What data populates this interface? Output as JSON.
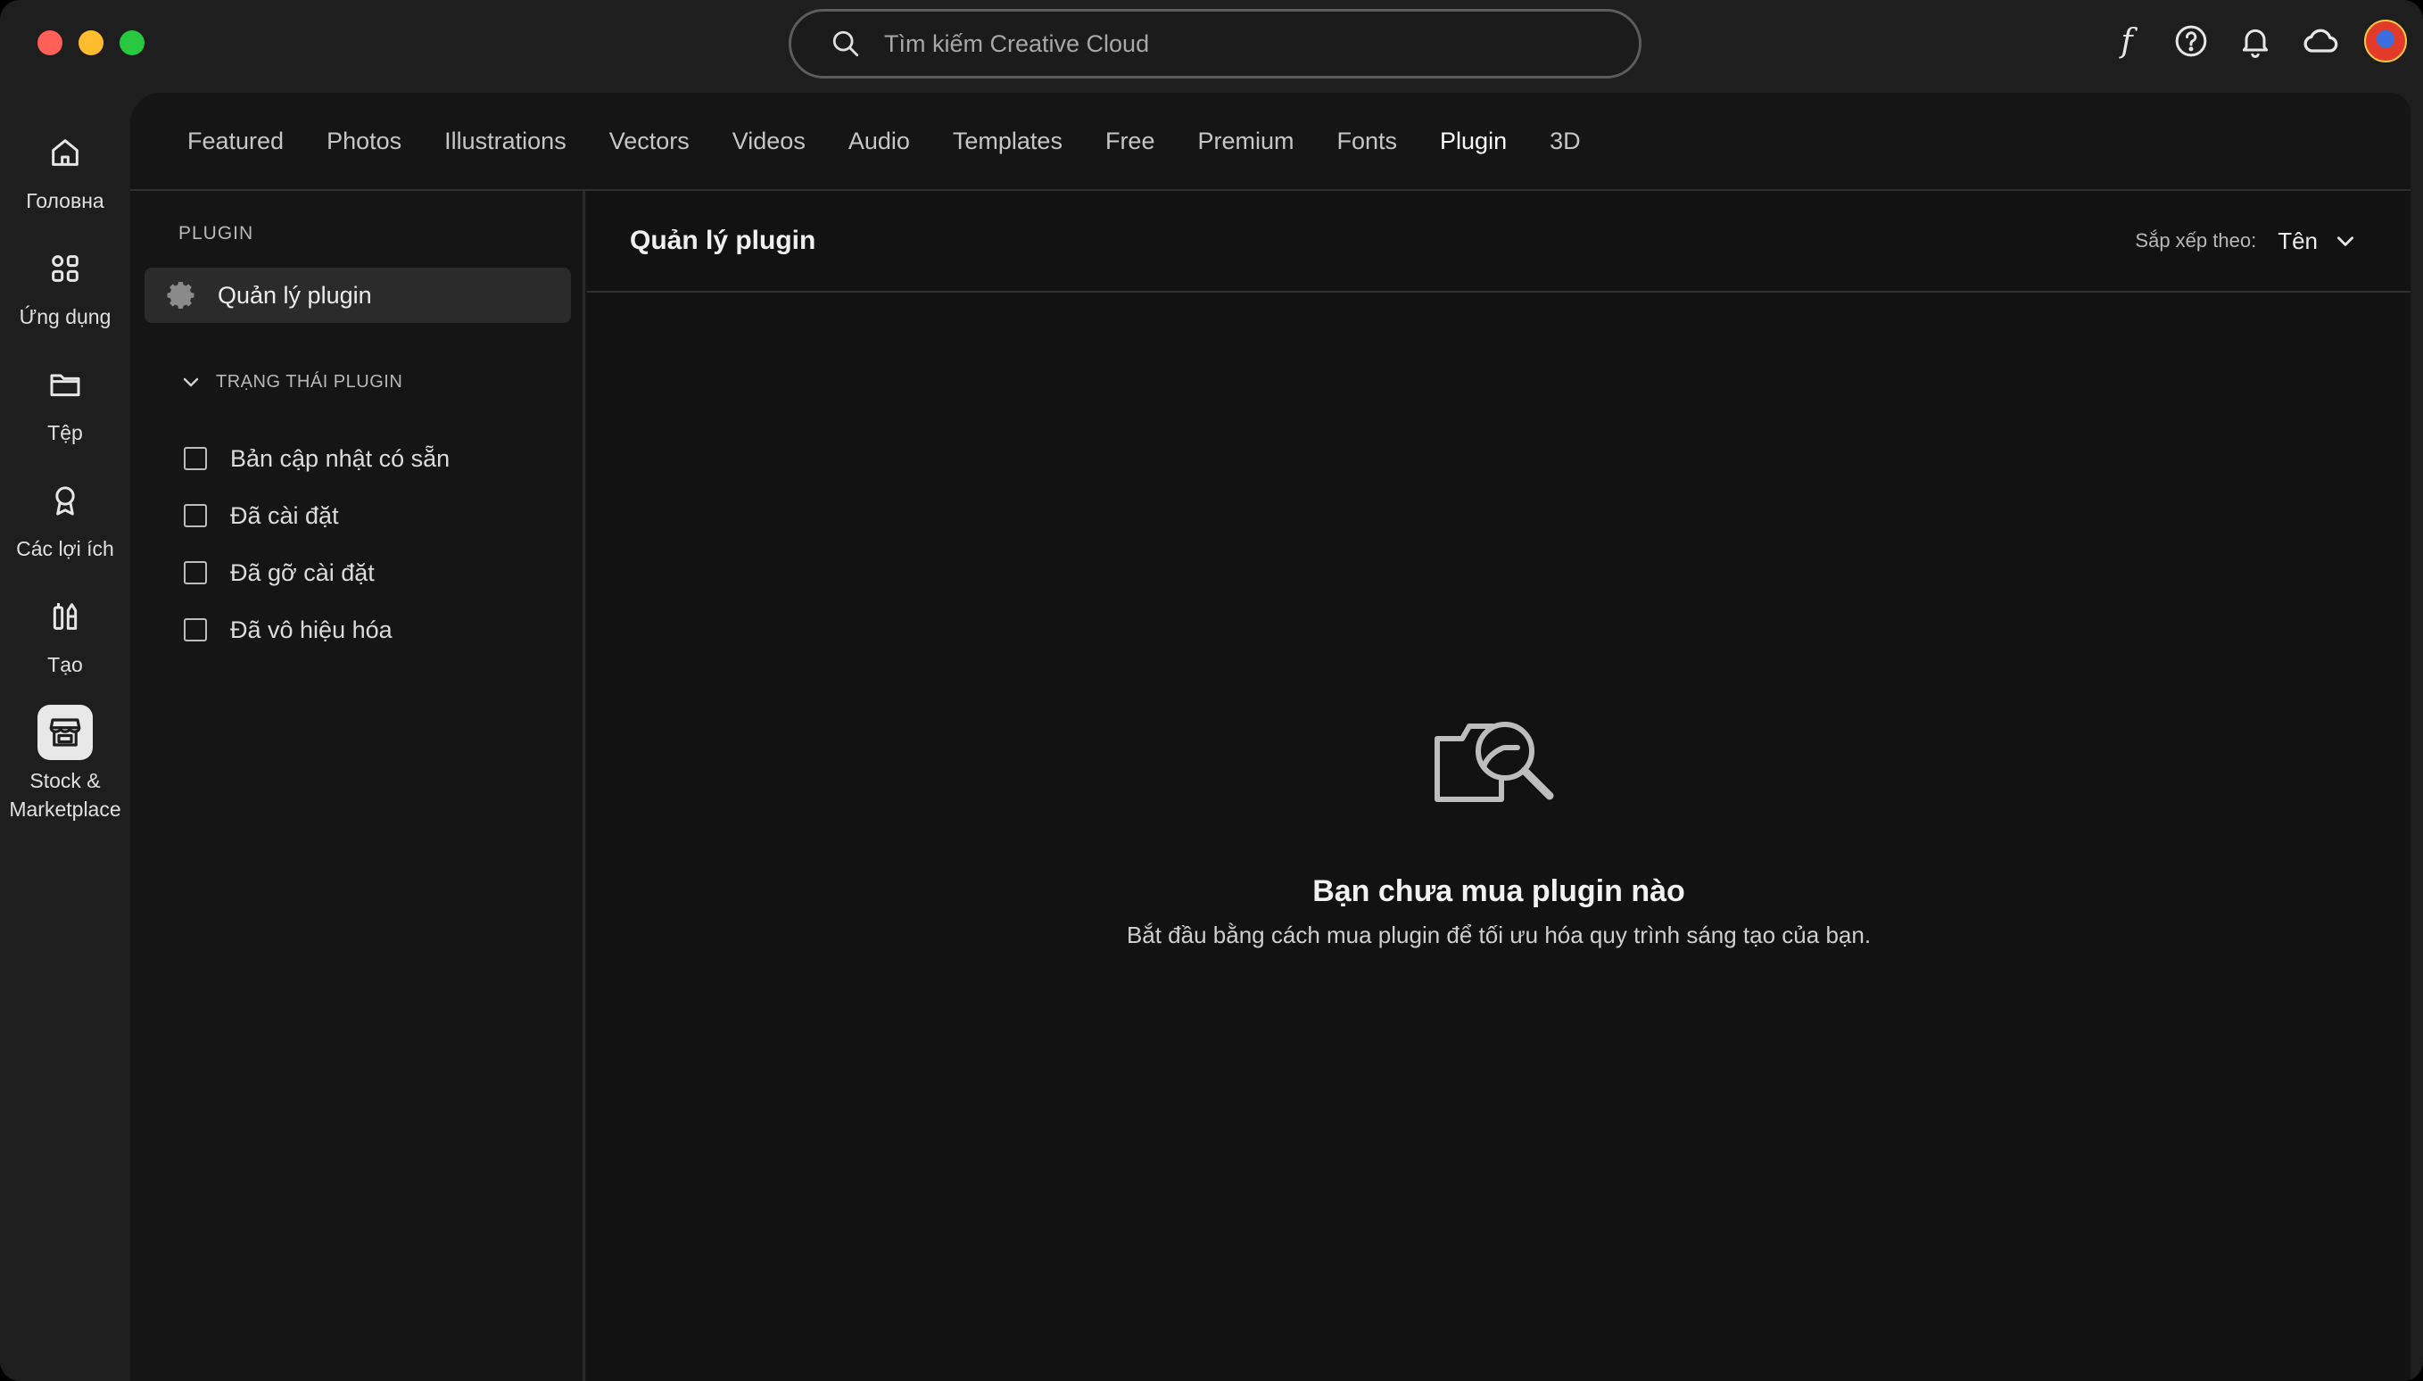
{
  "search": {
    "placeholder": "Tìm kiếm Creative Cloud"
  },
  "rail": {
    "items": [
      {
        "label": "Головна"
      },
      {
        "label": "Ứng dụng"
      },
      {
        "label": "Tệp"
      },
      {
        "label": "Các lợi ích"
      },
      {
        "label": "Tạo"
      },
      {
        "label_line1": "Stock &",
        "label_line2": "Marketplace"
      }
    ]
  },
  "tabs": [
    {
      "label": "Featured"
    },
    {
      "label": "Photos"
    },
    {
      "label": "Illustrations"
    },
    {
      "label": "Vectors"
    },
    {
      "label": "Videos"
    },
    {
      "label": "Audio"
    },
    {
      "label": "Templates"
    },
    {
      "label": "Free"
    },
    {
      "label": "Premium"
    },
    {
      "label": "Fonts"
    },
    {
      "label": "Plugin"
    },
    {
      "label": "3D"
    }
  ],
  "active_tab": "Plugin",
  "filters": {
    "heading": "PLUGIN",
    "manage_label": "Quản lý plugin",
    "status_heading": "TRẠNG THÁI PLUGIN",
    "options": [
      {
        "label": "Bản cập nhật có sẵn"
      },
      {
        "label": "Đã cài đặt"
      },
      {
        "label": "Đã gỡ cài đặt"
      },
      {
        "label": "Đã vô hiệu hóa"
      }
    ]
  },
  "content": {
    "title": "Quản lý plugin",
    "sort_label": "Sắp xếp theo:",
    "sort_value": "Tên",
    "empty_title": "Bạn chưa mua plugin nào",
    "empty_subtitle": "Bắt đầu bằng cách mua plugin để tối ưu hóa quy trình sáng tạo của bạn."
  },
  "icons": {
    "top": [
      "fonts-icon",
      "help-icon",
      "notifications-bell-icon",
      "cloud-icon",
      "user-avatar"
    ],
    "rail": [
      "home-icon",
      "apps-grid-icon",
      "folder-icon",
      "award-ribbon-icon",
      "create-tools-icon",
      "stock-marketplace-store-icon"
    ]
  },
  "colors": {
    "window_bg": "#1e1e1e",
    "panel_bg": "#151515",
    "content_bg": "#121212",
    "traffic_red": "#fe5f57",
    "traffic_yellow": "#febc2e",
    "traffic_green": "#28c840"
  }
}
